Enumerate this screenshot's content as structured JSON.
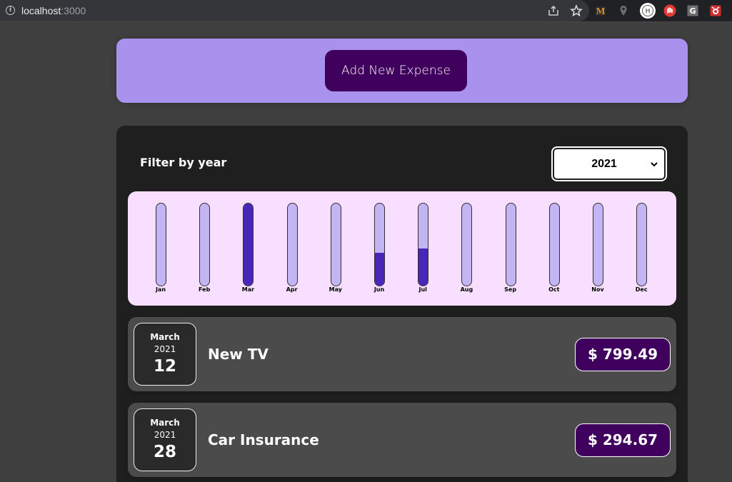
{
  "browser": {
    "host": "localhost",
    "port": ":3000"
  },
  "new_expense": {
    "add_button_label": "Add New Expense"
  },
  "filter": {
    "label": "Filter by year",
    "selected_year": "2021"
  },
  "chart_data": {
    "type": "bar",
    "categories": [
      "Jan",
      "Feb",
      "Mar",
      "Apr",
      "May",
      "Jun",
      "Jul",
      "Aug",
      "Sep",
      "Oct",
      "Nov",
      "Dec"
    ],
    "values": [
      0,
      0,
      1.0,
      0,
      0,
      0.4,
      0.45,
      0,
      0,
      0,
      0,
      0
    ],
    "colors": {
      "track": "#c3b4f3",
      "fill": "#4826b9",
      "background": "#f8dfff"
    }
  },
  "expenses": [
    {
      "month": "March",
      "year": "2021",
      "day": "12",
      "title": "New TV",
      "amount": "$ 799.49"
    },
    {
      "month": "March",
      "year": "2021",
      "day": "28",
      "title": "Car Insurance",
      "amount": "$ 294.67"
    }
  ],
  "colors": {
    "accent": "#40005d",
    "panel": "#a892ee",
    "card": "#1f1f1f",
    "item": "#4b4b4b"
  }
}
